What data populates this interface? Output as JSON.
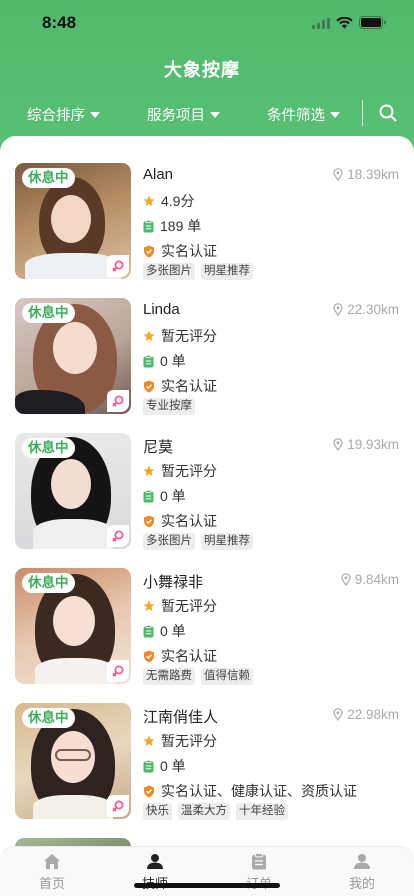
{
  "status": {
    "time": "8:48"
  },
  "app": {
    "title": "大象按摩"
  },
  "filters": [
    {
      "label": "综合排序"
    },
    {
      "label": "服务项目"
    },
    {
      "label": "条件筛选"
    }
  ],
  "therapists": [
    {
      "name": "Alan",
      "distance": "18.39km",
      "status": "休息中",
      "rating": "4.9分",
      "orders": "189 单",
      "certification": "实名认证",
      "tags": [
        "多张图片",
        "明星推荐"
      ]
    },
    {
      "name": "Linda",
      "distance": "22.30km",
      "status": "休息中",
      "rating": "暂无评分",
      "orders": "0 单",
      "certification": "实名认证",
      "tags": [
        "专业按摩"
      ]
    },
    {
      "name": "尼莫",
      "distance": "19.93km",
      "status": "休息中",
      "rating": "暂无评分",
      "orders": "0 单",
      "certification": "实名认证",
      "tags": [
        "多张图片",
        "明星推荐"
      ]
    },
    {
      "name": "小舞禄非",
      "distance": "9.84km",
      "status": "休息中",
      "rating": "暂无评分",
      "orders": "0 单",
      "certification": "实名认证",
      "tags": [
        "无需路费",
        "值得信赖"
      ]
    },
    {
      "name": "江南俏佳人",
      "distance": "22.98km",
      "status": "休息中",
      "rating": "暂无评分",
      "orders": "0 单",
      "certification": "实名认证、健康认证、资质认证",
      "tags": [
        "快乐",
        "温柔大方",
        "十年经验"
      ]
    }
  ],
  "tabbar": [
    {
      "label": "首页",
      "icon": "home-icon"
    },
    {
      "label": "技师",
      "icon": "person-icon"
    },
    {
      "label": "订单",
      "icon": "clipboard-icon"
    },
    {
      "label": "我的",
      "icon": "profile-icon"
    }
  ],
  "colors": {
    "brand_green": "#55bd71",
    "status_tag_text": "#3cae5b",
    "star": "#f5a623",
    "orders_icon": "#4cb868",
    "cert_badge": "#f08a24",
    "gender": "#ff5a8f"
  }
}
